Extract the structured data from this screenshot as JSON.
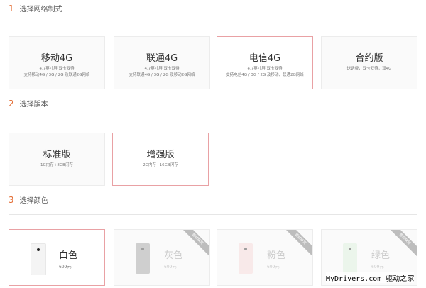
{
  "sections": [
    {
      "num": "1",
      "title": "选择网络制式"
    },
    {
      "num": "2",
      "title": "选择版本"
    },
    {
      "num": "3",
      "title": "选择颜色"
    }
  ],
  "networks": [
    {
      "title": "移动4G",
      "line1": "4.7英寸屏 双卡双待",
      "line2": "支持移动4G / 3G / 2G 及联通2G网络"
    },
    {
      "title": "联通4G",
      "line1": "4.7英寸屏 双卡双待",
      "line2": "支持联通4G / 3G / 2G 及移动2G网络"
    },
    {
      "title": "电信4G",
      "line1": "4.7英寸屏 双卡双待",
      "line2": "支持电信4G / 3G / 2G 及移动、联通2G网络"
    },
    {
      "title": "合约版",
      "line1": "送话费，双卡双待，双4G",
      "line2": ""
    }
  ],
  "versions": [
    {
      "title": "标准版",
      "line1": "1G内存+8GB闪存"
    },
    {
      "title": "增强版",
      "line1": "2G内存+16GB闪存"
    }
  ],
  "colors": [
    {
      "title": "白色",
      "price": "699元",
      "swatch": "#f4f4f4"
    },
    {
      "title": "灰色",
      "price": "699元",
      "swatch": "#bdbdbd",
      "ribbon": "暂时缺货"
    },
    {
      "title": "粉色",
      "price": "699元",
      "swatch": "#f8e2e2",
      "ribbon": "暂时缺货"
    },
    {
      "title": "绿色",
      "price": "699元",
      "swatch": "#e5f3e5",
      "ribbon": "暂时缺货"
    }
  ],
  "watermark": "MyDrivers.com 驱动之家"
}
